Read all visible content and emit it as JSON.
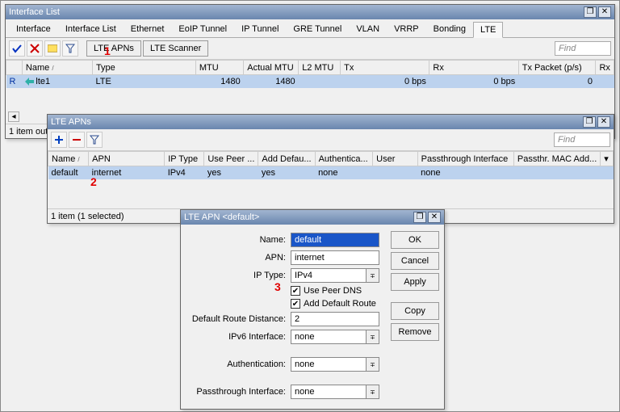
{
  "win1": {
    "title": "Interface List",
    "tabs": [
      "Interface",
      "Interface List",
      "Ethernet",
      "EoIP Tunnel",
      "IP Tunnel",
      "GRE Tunnel",
      "VLAN",
      "VRRP",
      "Bonding",
      "LTE"
    ],
    "active_tab": "LTE",
    "toolbar": {
      "lteapns": "LTE APNs",
      "ltescanner": "LTE Scanner"
    },
    "find": "Find",
    "cols": [
      "",
      "Name",
      "Type",
      "MTU",
      "Actual MTU",
      "L2 MTU",
      "Tx",
      "Rx",
      "Tx Packet (p/s)",
      "Rx"
    ],
    "row": {
      "flag": "R",
      "name": "lte1",
      "type": "LTE",
      "mtu": "1480",
      "amtu": "1480",
      "l2mtu": "",
      "tx": "0 bps",
      "rx": "0 bps",
      "txp": "0"
    },
    "status": "1 item out of"
  },
  "win2": {
    "title": "LTE APNs",
    "find": "Find",
    "cols": [
      "Name",
      "APN",
      "IP Type",
      "Use Peer ...",
      "Add Defau...",
      "Authentica...",
      "User",
      "Passthrough Interface",
      "Passthr. MAC Add..."
    ],
    "row": {
      "name": "default",
      "apn": "internet",
      "iptype": "IPv4",
      "peerdns": "yes",
      "adddef": "yes",
      "auth": "none",
      "user": "",
      "ptif": "none",
      "ptmac": ""
    },
    "status": "1 item (1 selected)"
  },
  "win3": {
    "title": "LTE APN <default>",
    "labels": {
      "name": "Name:",
      "apn": "APN:",
      "iptype": "IP Type:",
      "peerdns": "Use Peer DNS",
      "adddef": "Add Default Route",
      "drd": "Default Route Distance:",
      "ipv6": "IPv6 Interface:",
      "auth": "Authentication:",
      "pt": "Passthrough Interface:"
    },
    "values": {
      "name": "default",
      "apn": "internet",
      "iptype": "IPv4",
      "drd": "2",
      "ipv6": "none",
      "auth": "none",
      "pt": "none"
    },
    "buttons": {
      "ok": "OK",
      "cancel": "Cancel",
      "apply": "Apply",
      "copy": "Copy",
      "remove": "Remove"
    }
  },
  "markers": {
    "m1": "1",
    "m2": "2",
    "m3": "3"
  }
}
